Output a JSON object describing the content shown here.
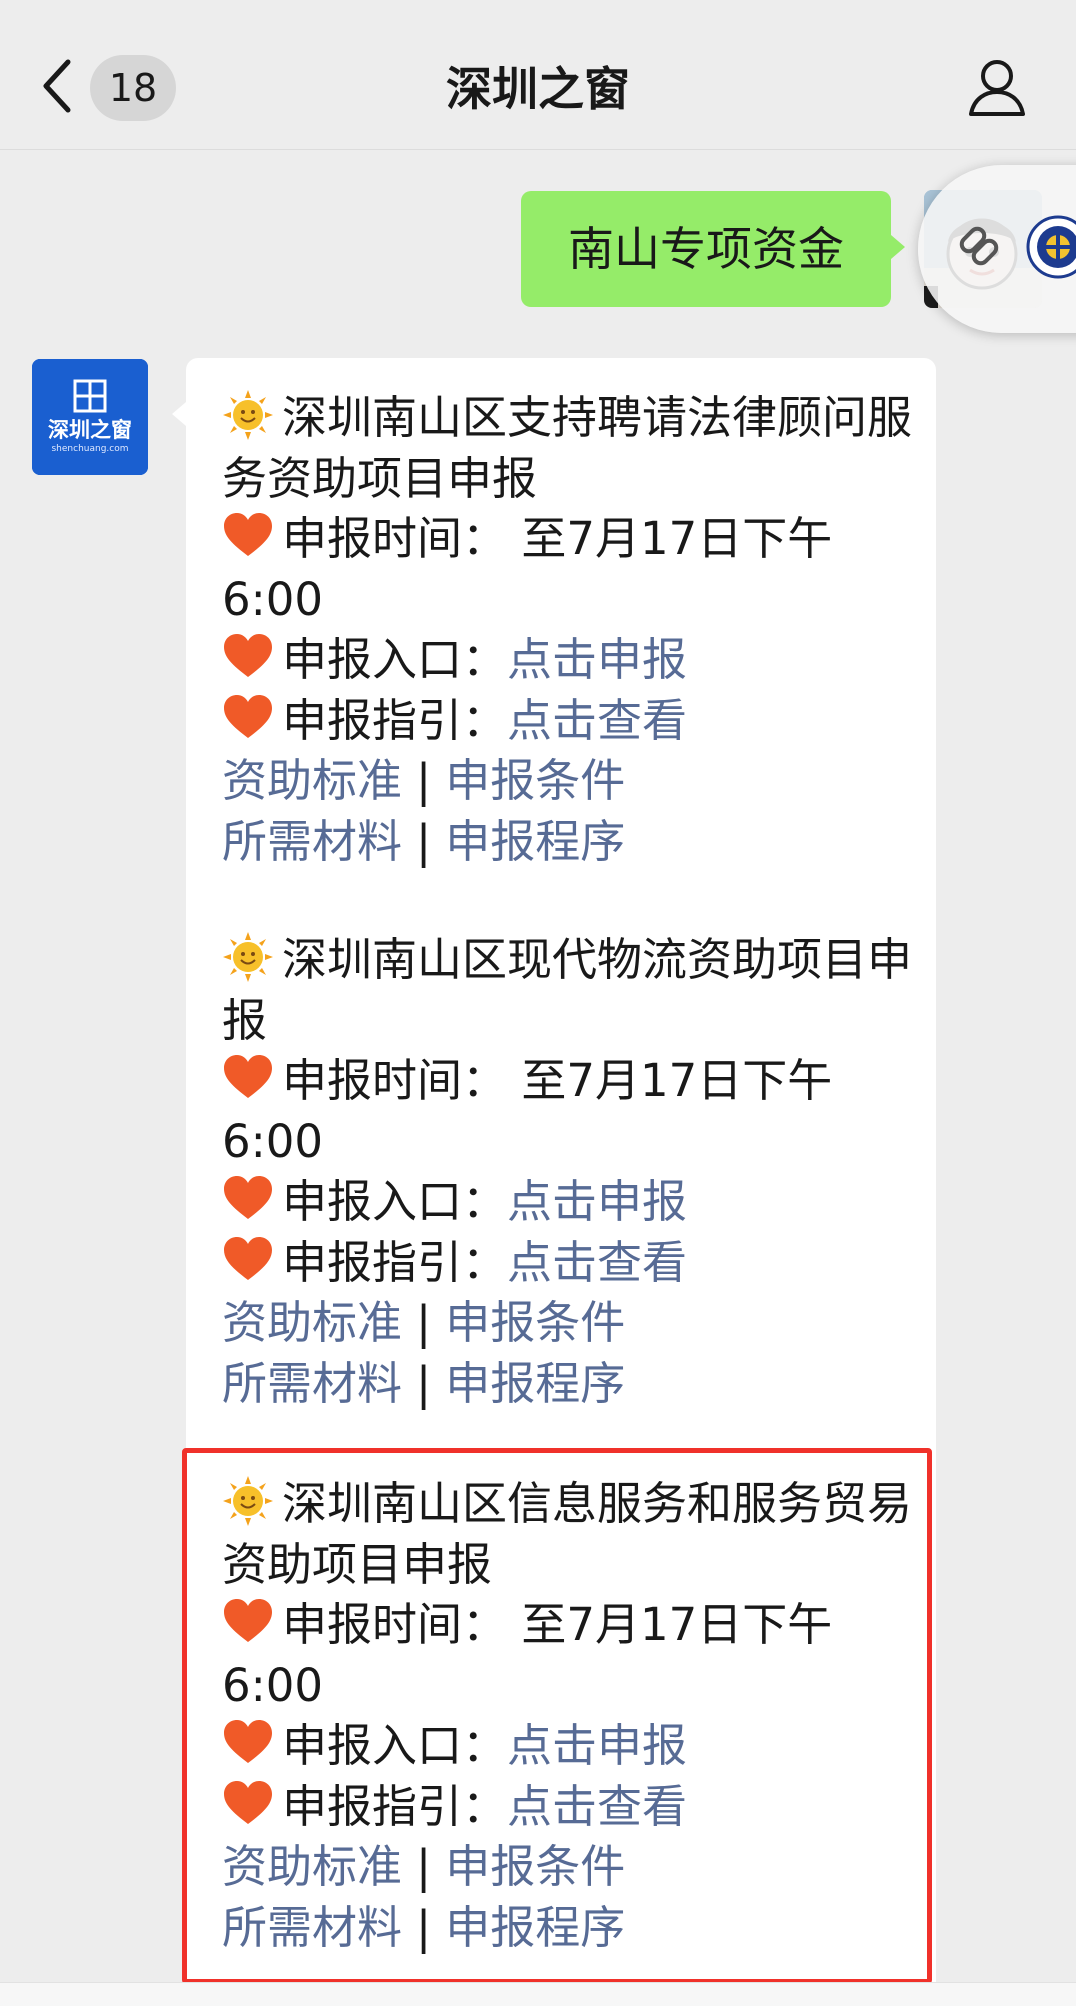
{
  "header": {
    "title": "深圳之窗",
    "unread_count": "18"
  },
  "sent_message": {
    "text": "南山专项资金"
  },
  "official_account": {
    "logo_text": "深圳之窗",
    "logo_subtext": "shenchuang.com"
  },
  "projects": [
    {
      "title": "深圳南山区支持聘请法律顾问服务资助项目申报",
      "time_label": "申报时间：",
      "time_value": "至7月17日下午6:00",
      "entry_label": "申报入口：",
      "entry_link": "点击申报",
      "guide_label": "申报指引：",
      "guide_link": "点击查看",
      "links_row1": [
        "资助标准",
        "申报条件"
      ],
      "links_row2": [
        "所需材料",
        "申报程序"
      ],
      "separator": "|"
    },
    {
      "title": "深圳南山区现代物流资助项目申报",
      "time_label": "申报时间：",
      "time_value": "至7月17日下午6:00",
      "entry_label": "申报入口：",
      "entry_link": "点击申报",
      "guide_label": "申报指引：",
      "guide_link": "点击查看",
      "links_row1": [
        "资助标准",
        "申报条件"
      ],
      "links_row2": [
        "所需材料",
        "申报程序"
      ],
      "separator": "|"
    },
    {
      "title": "深圳南山区信息服务和服务贸易资助项目申报",
      "time_label": "申报时间：",
      "time_value": "至7月17日下午6:00",
      "entry_label": "申报入口：",
      "entry_link": "点击申报",
      "guide_label": "申报指引：",
      "guide_link": "点击查看",
      "links_row1": [
        "资助标准",
        "申报条件"
      ],
      "links_row2": [
        "所需材料",
        "申报程序"
      ],
      "separator": "|"
    }
  ],
  "icons": {
    "title_emoji": "sun-face-icon",
    "item_emoji": "heart-icon"
  },
  "colors": {
    "sent_bubble": "#95ec69",
    "link": "#576b95",
    "highlight": "#f0312a",
    "official_logo_bg": "#1a5fd0"
  }
}
